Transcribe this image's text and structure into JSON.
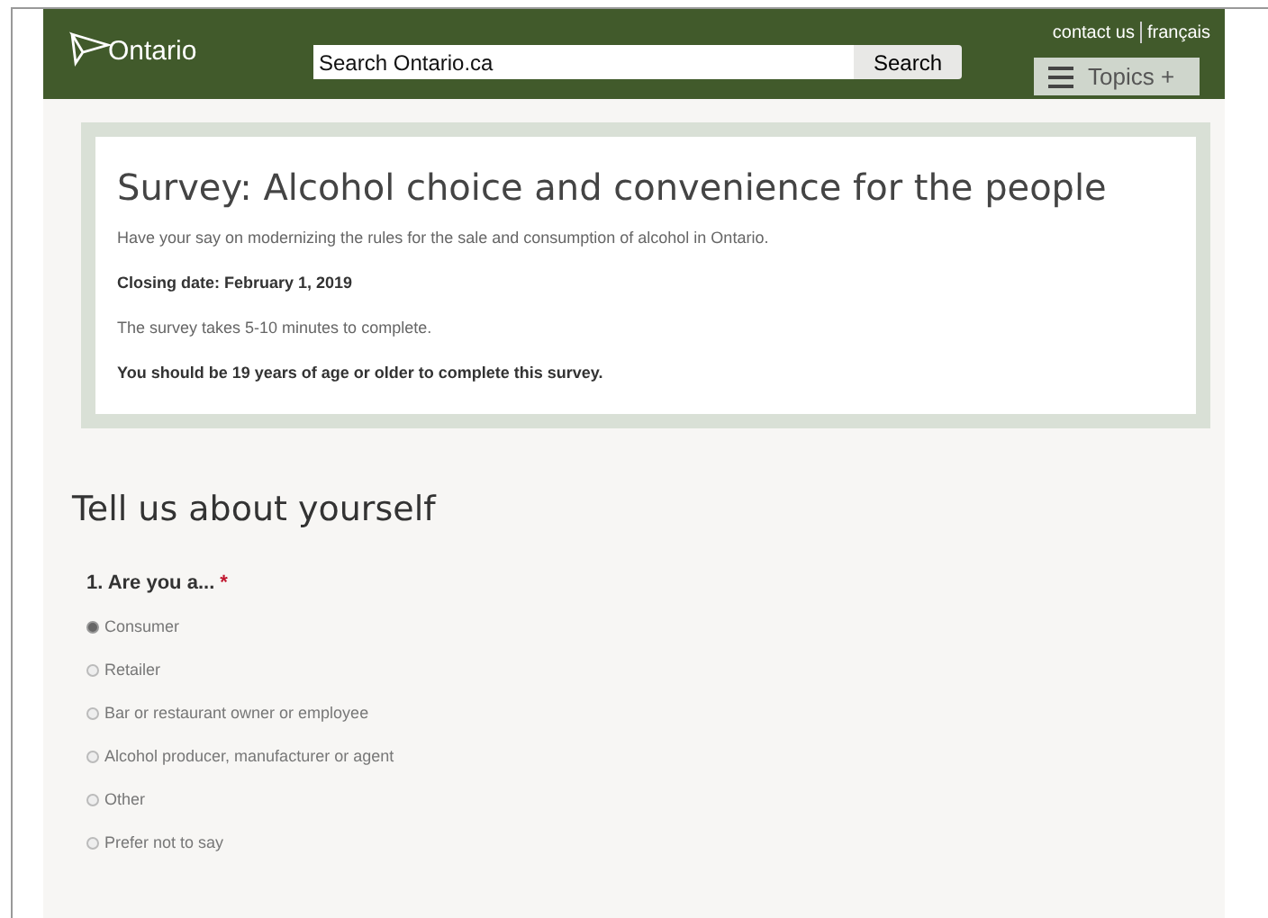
{
  "header": {
    "logo": "Ontario",
    "search": {
      "value": "Search Ontario.ca",
      "button": "Search"
    },
    "links": [
      "contact us",
      "français"
    ],
    "topics": "Topics +"
  },
  "survey": {
    "title": "Survey: Alcohol choice and convenience for the people",
    "paragraphs": [
      {
        "kind": "plain",
        "text": "Have your say on modernizing the rules for the sale and consumption of alcohol in Ontario."
      },
      {
        "kind": "bold",
        "text": "Closing date: February 1, 2019"
      },
      {
        "kind": "plain",
        "text": "The survey takes 5-10 minutes to complete."
      },
      {
        "kind": "bold",
        "text": "You should be 19 years of age or older to complete this survey."
      }
    ]
  },
  "section": {
    "title": "Tell us about yourself",
    "question": {
      "label": "1. Are you a...",
      "required": "*",
      "options": [
        {
          "label": "Consumer",
          "selected": true
        },
        {
          "label": "Retailer",
          "selected": false
        },
        {
          "label": "Bar or restaurant owner or employee",
          "selected": false
        },
        {
          "label": "Alcohol producer, manufacturer or agent",
          "selected": false
        },
        {
          "label": "Other",
          "selected": false
        },
        {
          "label": "Prefer not to say",
          "selected": false
        }
      ]
    }
  }
}
